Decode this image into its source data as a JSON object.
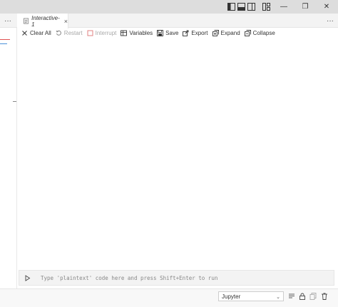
{
  "titlebar": {
    "icons": [
      "toggle-primary-sidebar-icon",
      "toggle-panel-icon",
      "toggle-secondary-sidebar-icon",
      "customize-layout-icon"
    ],
    "minimize_glyph": "—",
    "restore_glyph": "❐",
    "close_glyph": "✕"
  },
  "tabs": {
    "left_more": "···",
    "right_more": "···",
    "items": [
      {
        "label": "Interactive-1",
        "close": "×",
        "icon": "interactive-file-icon"
      }
    ]
  },
  "toolbar": {
    "clear_all": "Clear All",
    "restart": "Restart",
    "interrupt": "Interrupt",
    "variables": "Variables",
    "save": "Save",
    "export": "Export",
    "expand": "Expand",
    "collapse": "Collapse"
  },
  "input": {
    "placeholder": "Type 'plaintext' code here and press Shift+Enter to run"
  },
  "bottom": {
    "kernel_select_value": "Jupyter",
    "caret": "⌄",
    "icons": [
      "list-icon",
      "lock-icon",
      "copy-icon",
      "trash-icon"
    ]
  },
  "colors": {
    "titlebar_bg": "#dddddd",
    "tabrow_bg": "#f3f3f3",
    "input_bg": "#f3f3f3",
    "accent_red": "#e05252",
    "accent_blue": "#4a90d9"
  }
}
